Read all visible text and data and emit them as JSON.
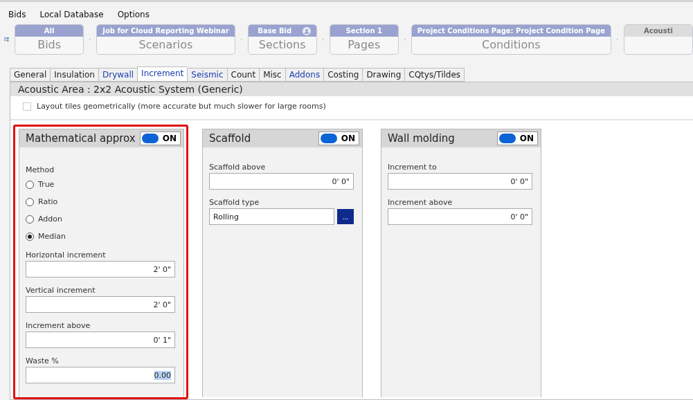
{
  "menu": [
    "Bids",
    "Local Database",
    "Options"
  ],
  "breadcrumbs": [
    {
      "caption": "All",
      "title": "Bids",
      "enabled": true,
      "user_icon": false
    },
    {
      "caption": "Job for Cloud Reporting Webinar",
      "title": "Scenarios",
      "enabled": true,
      "user_icon": false
    },
    {
      "caption": "Base Bid",
      "title": "Sections",
      "enabled": true,
      "user_icon": true
    },
    {
      "caption": "Section 1",
      "title": "Pages",
      "enabled": true,
      "user_icon": false
    },
    {
      "caption": "Project Conditions Page: Project Condition Page",
      "title": "Conditions",
      "enabled": true,
      "user_icon": false
    },
    {
      "caption": "Acousti",
      "enabled": false,
      "user_icon": false
    }
  ],
  "tabs": [
    {
      "label": "General",
      "selected": false,
      "linked": false
    },
    {
      "label": "Insulation",
      "selected": false,
      "linked": false
    },
    {
      "label": "Drywall",
      "selected": false,
      "linked": true
    },
    {
      "label": "Increment",
      "selected": true,
      "linked": true
    },
    {
      "label": "Seismic",
      "selected": false,
      "linked": true
    },
    {
      "label": "Count",
      "selected": false,
      "linked": false
    },
    {
      "label": "Misc",
      "selected": false,
      "linked": false
    },
    {
      "label": "Addons",
      "selected": false,
      "linked": true
    },
    {
      "label": "Costing",
      "selected": false,
      "linked": false
    },
    {
      "label": "Drawing",
      "selected": false,
      "linked": false
    },
    {
      "label": "CQtys/Tildes",
      "selected": false,
      "linked": false
    }
  ],
  "header": "Acoustic Area : 2x2 Acoustic System (Generic)",
  "layout_option": {
    "label": "Layout tiles geometrically (more accurate but much slower for large rooms)",
    "checked": false
  },
  "panels": [
    {
      "title": "Mathematical approx",
      "toggle": "ON",
      "on": true,
      "highlighted": true,
      "items": [
        {
          "kind": "label",
          "label": "Method"
        },
        {
          "kind": "radio",
          "label": "True",
          "selected": false
        },
        {
          "kind": "radio",
          "label": "Ratio",
          "selected": false
        },
        {
          "kind": "radio",
          "label": "Addon",
          "selected": false
        },
        {
          "kind": "radio",
          "label": "Median",
          "selected": true
        },
        {
          "kind": "field",
          "label": "Horizontal increment",
          "value": "2' 0\"",
          "text_selected": false
        },
        {
          "kind": "field",
          "label": "Vertical increment",
          "value": "2' 0\"",
          "text_selected": false
        },
        {
          "kind": "field",
          "label": "Increment above",
          "value": "0' 1\"",
          "text_selected": false
        },
        {
          "kind": "field",
          "label": "Waste %",
          "value": "0.00",
          "text_selected": true
        }
      ]
    },
    {
      "title": "Scaffold",
      "toggle": "ON",
      "on": true,
      "highlighted": false,
      "items": [
        {
          "kind": "field",
          "label": "Scaffold above",
          "value": "0' 0\"",
          "text_selected": false
        },
        {
          "kind": "picker",
          "label": "Scaffold type",
          "value": "Rolling",
          "button": "..."
        }
      ]
    },
    {
      "title": "Wall molding",
      "toggle": "ON",
      "on": true,
      "highlighted": false,
      "items": [
        {
          "kind": "field",
          "label": "Increment to",
          "value": "0' 0\"",
          "text_selected": false
        },
        {
          "kind": "field",
          "label": "Increment above",
          "value": "0' 0\"",
          "text_selected": false
        }
      ]
    }
  ]
}
